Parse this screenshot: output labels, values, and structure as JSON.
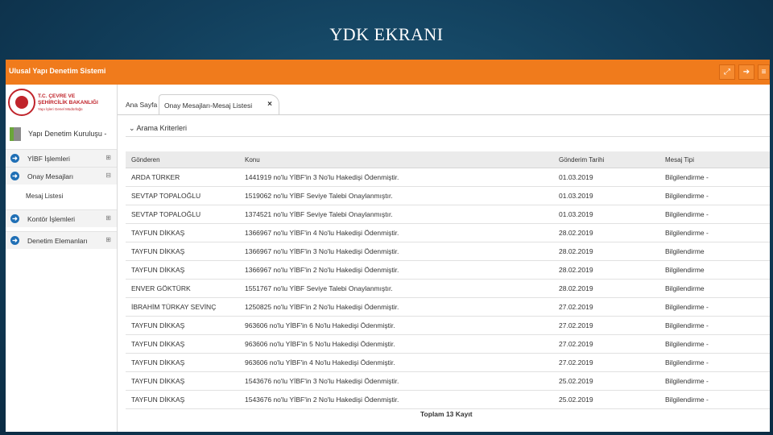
{
  "slide": {
    "title": "YDK EKRANI"
  },
  "header": {
    "app_title": "Ulusal Yapı Denetim Sistemi",
    "buttons": [
      {
        "icon": "fullscreen-icon",
        "glyph": "⤢"
      },
      {
        "icon": "logout-icon",
        "glyph": "➔"
      },
      {
        "icon": "menu-icon",
        "glyph": "≡"
      }
    ]
  },
  "logo": {
    "line1": "T.C. ÇEVRE VE",
    "line2": "ŞEHİRCİLİK BAKANLIĞI",
    "line3": "Yapı İşleri Genel Müdürlüğü"
  },
  "user": {
    "name": "Yapı Denetim Kuruluşu -"
  },
  "sidebar": {
    "items": [
      {
        "label": "YİBF İşlemleri",
        "toggle": "⊞"
      },
      {
        "label": "Onay Mesajları",
        "toggle": "⊟"
      },
      {
        "label": "Kontör İşlemleri",
        "toggle": "⊞"
      },
      {
        "label": "Denetim Elemanları",
        "toggle": "⊞"
      }
    ],
    "sub_item": "Mesaj Listesi"
  },
  "tabs": {
    "home": "Ana Sayfa",
    "active": "Onay Mesajları-Mesaj Listesi",
    "close": "×"
  },
  "criteria": {
    "label": "⌄ Arama Kriterleri"
  },
  "table": {
    "headers": [
      "Gönderen",
      "Konu",
      "Gönderim Tarihi",
      "Mesaj Tipi"
    ],
    "rows": [
      [
        "ARDA TÜRKER",
        "1441919 no'lu YİBF'in 3 No'lu Hakedişi Ödenmiştir.",
        "01.03.2019",
        "Bilgilendirme -"
      ],
      [
        "SEVTAP TOPALOĞLU",
        "1519062 no'lu YİBF Seviye Talebi Onaylanmıştır.",
        "01.03.2019",
        "Bilgilendirme -"
      ],
      [
        "SEVTAP TOPALOĞLU",
        "1374521 no'lu YİBF Seviye Talebi Onaylanmıştır.",
        "01.03.2019",
        "Bilgilendirme -"
      ],
      [
        "TAYFUN DİKKAŞ",
        "1366967 no'lu YİBF'in 4 No'lu Hakedişi Ödenmiştir.",
        "28.02.2019",
        "Bilgilendirme -"
      ],
      [
        "TAYFUN DİKKAŞ",
        "1366967 no'lu YİBF'in 3 No'lu Hakedişi Ödenmiştir.",
        "28.02.2019",
        "Bilgilendirme"
      ],
      [
        "TAYFUN DİKKAŞ",
        "1366967 no'lu YİBF'in 2 No'lu Hakedişi Ödenmiştir.",
        "28.02.2019",
        "Bilgilendirme"
      ],
      [
        "ENVER GÖKTÜRK",
        "1551767 no'lu YİBF Seviye Talebi Onaylanmıştır.",
        "28.02.2019",
        "Bilgilendirme"
      ],
      [
        "İBRAHİM TÜRKAY SEVİNÇ",
        "1250825 no'lu YİBF'in 2 No'lu Hakedişi Ödenmiştir.",
        "27.02.2019",
        "Bilgilendirme -"
      ],
      [
        "TAYFUN DİKKAŞ",
        "963606 no'lu YİBF'in 6 No'lu Hakedişi Ödenmiştir.",
        "27.02.2019",
        "Bilgilendirme -"
      ],
      [
        "TAYFUN DİKKAŞ",
        "963606 no'lu YİBF'in 5 No'lu Hakedişi Ödenmiştir.",
        "27.02.2019",
        "Bilgilendirme -"
      ],
      [
        "TAYFUN DİKKAŞ",
        "963606 no'lu YİBF'in 4 No'lu Hakedişi Ödenmiştir.",
        "27.02.2019",
        "Bilgilendirme -"
      ],
      [
        "TAYFUN DİKKAŞ",
        "1543676 no'lu YİBF'in 3 No'lu Hakedişi Ödenmiştir.",
        "25.02.2019",
        "Bilgilendirme -"
      ],
      [
        "TAYFUN DİKKAŞ",
        "1543676 no'lu YİBF'in 2 No'lu Hakedişi Ödenmiştir.",
        "25.02.2019",
        "Bilgilendirme -"
      ]
    ],
    "total": "Toplam 13 Kayıt"
  },
  "colors": {
    "header": "#f07b1c",
    "slide_bg": "#123f5c",
    "menu_icon": "#1f6fb5",
    "logo_red": "#c0242b"
  }
}
